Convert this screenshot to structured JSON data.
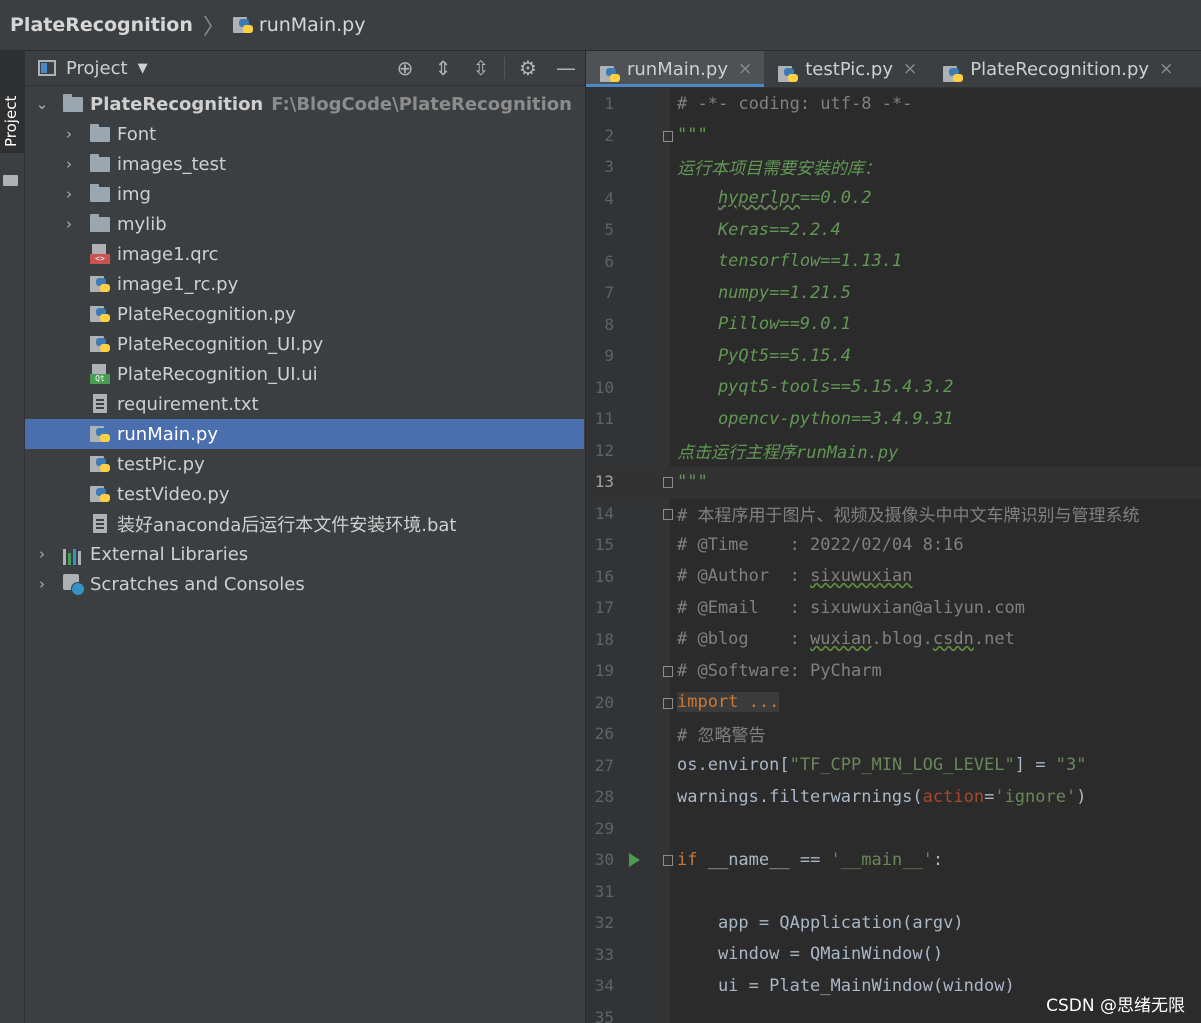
{
  "breadcrumb": {
    "project": "PlateRecognition",
    "file": "runMain.py"
  },
  "left_strip": {
    "tab_label": "Project"
  },
  "project_panel": {
    "title": "Project",
    "tree": [
      {
        "label": "PlateRecognition",
        "path": "F:\\BlogCode\\PlateRecognition",
        "icon": "folder-icon"
      },
      {
        "label": "Font",
        "icon": "folder-icon"
      },
      {
        "label": "images_test",
        "icon": "folder-icon"
      },
      {
        "label": "img",
        "icon": "folder-icon"
      },
      {
        "label": "mylib",
        "icon": "folder-icon"
      },
      {
        "label": "image1.qrc",
        "icon": "qrc-file-icon"
      },
      {
        "label": "image1_rc.py",
        "icon": "python-file-icon"
      },
      {
        "label": "PlateRecognition.py",
        "icon": "python-file-icon"
      },
      {
        "label": "PlateRecognition_UI.py",
        "icon": "python-file-icon"
      },
      {
        "label": "PlateRecognition_UI.ui",
        "icon": "qt-ui-file-icon"
      },
      {
        "label": "requirement.txt",
        "icon": "text-file-icon"
      },
      {
        "label": "runMain.py",
        "icon": "python-file-icon"
      },
      {
        "label": "testPic.py",
        "icon": "python-file-icon"
      },
      {
        "label": "testVideo.py",
        "icon": "python-file-icon"
      },
      {
        "label": "装好anaconda后运行本文件安装环境.bat",
        "icon": "text-file-icon"
      },
      {
        "label": "External Libraries",
        "icon": "library-icon"
      },
      {
        "label": "Scratches and Consoles",
        "icon": "scratches-icon"
      }
    ]
  },
  "editor": {
    "tabs": [
      {
        "label": "runMain.py",
        "close": "×"
      },
      {
        "label": "testPic.py",
        "close": "×"
      },
      {
        "label": "PlateRecognition.py",
        "close": "×"
      }
    ],
    "line_numbers": [
      "1",
      "2",
      "3",
      "4",
      "5",
      "6",
      "7",
      "8",
      "9",
      "10",
      "11",
      "12",
      "13",
      "14",
      "15",
      "16",
      "17",
      "18",
      "19",
      "20",
      "26",
      "27",
      "28",
      "29",
      "30",
      "31",
      "32",
      "33",
      "34",
      "35"
    ],
    "code": {
      "l1": "# -*- coding: utf-8 -*-",
      "l2": "\"\"\"",
      "l3": "运行本项目需要安装的库：",
      "l4a": "    ",
      "l4b": "hyperlpr",
      "l4c": "==0.0.2",
      "l5": "    Keras==2.2.4",
      "l6": "    tensorflow==1.13.1",
      "l7": "    numpy==1.21.5",
      "l8": "    Pillow==9.0.1",
      "l9": "    PyQt5==5.15.4",
      "l10": "    pyqt5-tools==5.15.4.3.2",
      "l11": "    opencv-python==3.4.9.31",
      "l12": "点击运行主程序runMain.py",
      "l13": "\"\"\"",
      "l14": "# 本程序用于图片、视频及摄像头中中文车牌识别与管理系统",
      "l15": "# @Time    : 2022/02/04 8:16",
      "l16a": "# @Author  : ",
      "l16b": "sixuwuxian",
      "l17": "# @Email   : sixuwuxian@aliyun.com",
      "l18a": "# @blog    : ",
      "l18b": "wuxian",
      "l18c": ".blog.",
      "l18d": "csdn",
      "l18e": ".net",
      "l19": "# @Software: PyCharm",
      "l20": "import ...",
      "l26": "# 忽略警告",
      "l27a": "os.environ[",
      "l27b": "\"TF_CPP_MIN_LOG_LEVEL\"",
      "l27c": "] = ",
      "l27d": "\"3\"",
      "l28a": "warnings.filterwarnings(",
      "l28b": "action",
      "l28c": "=",
      "l28d": "'ignore'",
      "l28e": ")",
      "l30a": "if",
      "l30b": " __name__ == ",
      "l30c": "'__main__'",
      "l30d": ":",
      "l32": "    app = QApplication(argv)",
      "l33": "    window = QMainWindow()",
      "l34": "    ui = Plate_MainWindow(window)"
    }
  },
  "watermark": "CSDN @思绪无限"
}
